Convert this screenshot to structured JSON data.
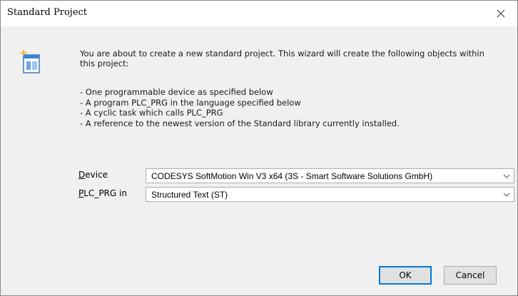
{
  "window": {
    "title": "Standard Project",
    "close_icon": "close-icon"
  },
  "intro": {
    "text": "You are about to create a new standard project. This wizard will create the following objects within this project:",
    "icon": "wizard-icon"
  },
  "bullets": [
    "- One programmable device as specified below",
    "- A program PLC_PRG in the language specified below",
    "- A cyclic task which calls PLC_PRG",
    "- A reference to the newest version of the Standard library currently installed."
  ],
  "device": {
    "label_underlined": "D",
    "label_rest": "evice",
    "value": "CODESYS SoftMotion Win V3 x64 (3S - Smart Software Solutions GmbH)"
  },
  "language": {
    "label_underlined": "P",
    "label_rest": "LC_PRG in",
    "value": "Structured Text (ST)"
  },
  "buttons": {
    "ok": "OK",
    "cancel": "Cancel"
  }
}
